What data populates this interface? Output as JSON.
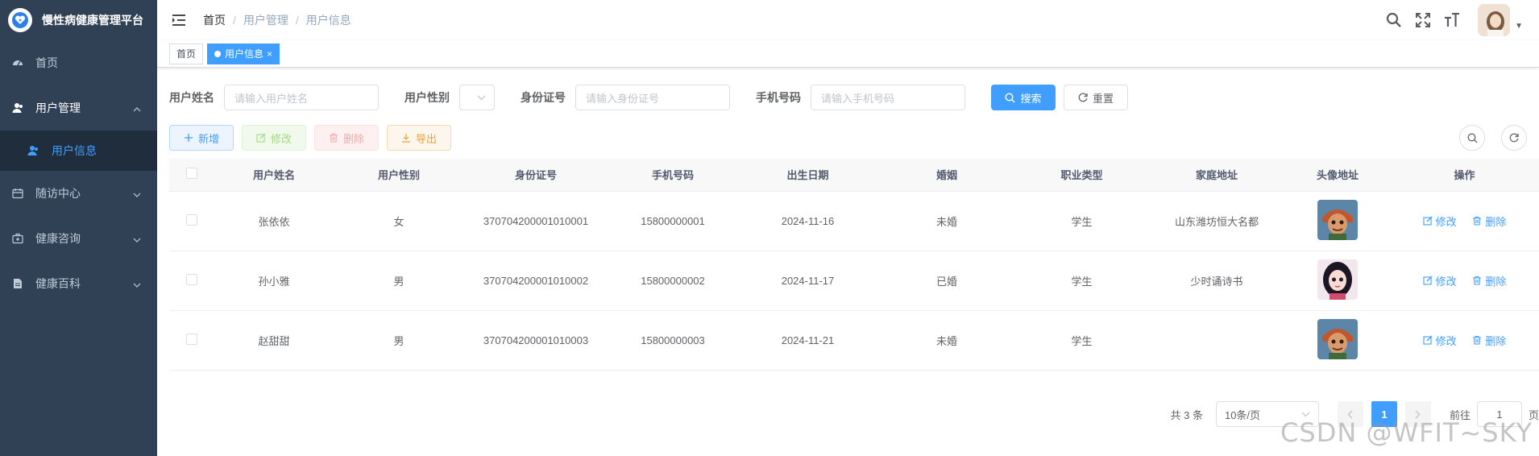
{
  "app": {
    "title": "慢性病健康管理平台"
  },
  "sidebar": {
    "items": [
      {
        "label": "首页",
        "icon": "dashboard-icon"
      },
      {
        "label": "用户管理",
        "icon": "user-icon",
        "expanded": true,
        "children": [
          {
            "label": "用户信息",
            "icon": "user-icon",
            "active": true
          }
        ]
      },
      {
        "label": "随访中心",
        "icon": "calendar-icon",
        "expanded": false
      },
      {
        "label": "健康咨询",
        "icon": "medkit-icon",
        "expanded": false
      },
      {
        "label": "健康百科",
        "icon": "document-icon",
        "expanded": false
      }
    ],
    "colors": {
      "bg": "#304156",
      "sub_bg": "#1f2d3d",
      "active": "#409eff"
    }
  },
  "header": {
    "breadcrumb": [
      "首页",
      "用户管理",
      "用户信息"
    ],
    "separator": "/"
  },
  "tags": [
    {
      "label": "首页",
      "active": false
    },
    {
      "label": "用户信息",
      "active": true,
      "close": "×"
    }
  ],
  "search": {
    "name_label": "用户姓名",
    "name_placeholder": "请输入用户姓名",
    "gender_label": "用户性别",
    "idcard_label": "身份证号",
    "idcard_placeholder": "请输入身份证号",
    "phone_label": "手机号码",
    "phone_placeholder": "请输入手机号码",
    "search_btn": "搜索",
    "reset_btn": "重置"
  },
  "toolbar": {
    "add": "新增",
    "edit": "修改",
    "delete": "删除",
    "export": "导出"
  },
  "table": {
    "columns": [
      "用户姓名",
      "用户性别",
      "身份证号",
      "手机号码",
      "出生日期",
      "婚姻",
      "职业类型",
      "家庭地址",
      "头像地址",
      "操作"
    ],
    "rows": [
      {
        "name": "张依依",
        "gender": "女",
        "idcard": "370704200001010001",
        "phone": "15800000001",
        "birth": "2024-11-16",
        "marriage": "未婚",
        "job": "学生",
        "address": "山东潍坊恒大名都",
        "avatar": "cartoon-boy"
      },
      {
        "name": "孙小雅",
        "gender": "男",
        "idcard": "370704200001010002",
        "phone": "15800000002",
        "birth": "2024-11-17",
        "marriage": "已婚",
        "job": "学生",
        "address": "少时诵诗书",
        "avatar": "cartoon-girl"
      },
      {
        "name": "赵甜甜",
        "gender": "男",
        "idcard": "370704200001010003",
        "phone": "15800000003",
        "birth": "2024-11-21",
        "marriage": "未婚",
        "job": "学生",
        "address": "",
        "avatar": "cartoon-boy"
      }
    ],
    "op_edit": "修改",
    "op_delete": "删除"
  },
  "pagination": {
    "total": "共 3 条",
    "page_size": "10条/页",
    "current": "1",
    "goto_prefix": "前往",
    "goto_value": "1",
    "goto_suffix": "页"
  },
  "watermark": "CSDN @WFIT~SKY"
}
